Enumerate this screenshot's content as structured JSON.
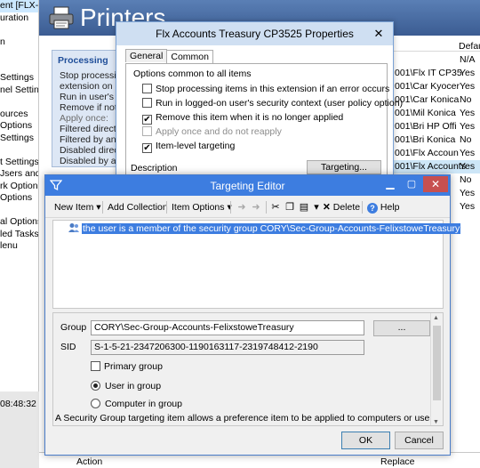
{
  "left_tree": {
    "items": [
      "ent [FLX-D",
      "uration",
      "",
      "n",
      "",
      "",
      "Settings",
      "nel Setting",
      "",
      "ources",
      "Options",
      "Settings",
      "",
      "t Settings",
      "Jsers and G",
      "rk Options",
      "Options",
      "",
      "al Options",
      "led Tasks",
      "lenu"
    ],
    "selected_index": 0
  },
  "left_status": {
    "time": "08:48:32"
  },
  "printers": {
    "title": "Printers"
  },
  "processing": {
    "title": "Processing",
    "lines": [
      {
        "text": "Stop processing",
        "muted": false
      },
      {
        "text": "extension on err",
        "muted": false
      },
      {
        "text": "Run in user's co",
        "muted": false
      },
      {
        "text": "Remove if not a",
        "muted": false
      },
      {
        "text": "Apply once:",
        "muted": true
      },
      {
        "text": "Filtered directly:",
        "muted": false
      },
      {
        "text": "Filtered by ance",
        "muted": false
      },
      {
        "text": "Disabled directly",
        "muted": false
      },
      {
        "text": "Disabled by anc",
        "muted": false
      }
    ]
  },
  "list": {
    "default_header": "Defau",
    "rows": [
      {
        "name": "",
        "def": "N/A",
        "selected": false
      },
      {
        "name": "001\\Flx IT CP35",
        "def": "Yes",
        "selected": false
      },
      {
        "name": "001\\Car Kyocer",
        "def": "Yes",
        "selected": false
      },
      {
        "name": "001\\Car Konica",
        "def": "No",
        "selected": false
      },
      {
        "name": "001\\Mil Konica",
        "def": "Yes",
        "selected": false
      },
      {
        "name": "001\\Bri HP Offi",
        "def": "Yes",
        "selected": false
      },
      {
        "name": "001\\Bri Konica",
        "def": "No",
        "selected": false
      },
      {
        "name": "001\\Flx Accoun",
        "def": "Yes",
        "selected": false
      },
      {
        "name": "001\\Flx Accounts",
        "def": "Yes",
        "selected": true
      },
      {
        "name": "",
        "def": "No",
        "selected": false
      },
      {
        "name": "",
        "def": "Yes",
        "selected": false
      },
      {
        "name": "",
        "def": "Yes",
        "selected": false
      }
    ]
  },
  "bottom_bar": {
    "action": "Action",
    "replace": "Replace"
  },
  "properties_dialog": {
    "title": "Flx Accounts Treasury CP3525 Properties",
    "close": "✕",
    "tabs": [
      "General",
      "Common"
    ],
    "active_tab": "Common",
    "group_label": "Options common to all items",
    "options": [
      {
        "label": "Stop processing items in this extension if an error occurs",
        "checked": false,
        "disabled": false
      },
      {
        "label": "Run in logged-on user's security context (user policy option)",
        "checked": false,
        "disabled": false
      },
      {
        "label": "Remove this item when it is no longer applied",
        "checked": true,
        "disabled": false
      },
      {
        "label": "Apply once and do not reapply",
        "checked": false,
        "disabled": true
      },
      {
        "label": "Item-level targeting",
        "checked": true,
        "disabled": false
      }
    ],
    "targeting_button": "Targeting...",
    "description_label": "Description"
  },
  "targeting_editor": {
    "title": "Targeting Editor",
    "toolbar": {
      "new_item": "New Item",
      "add_collection": "Add Collection",
      "item_options": "Item Options",
      "delete": "Delete",
      "help": "Help"
    },
    "tree_item": "the user is a member of the security group CORY\\Sec-Group-Accounts-FelixstoweTreasury",
    "group_label": "Group",
    "group_value": "CORY\\Sec-Group-Accounts-FelixstoweTreasury",
    "browse_label": "...",
    "sid_label": "SID",
    "sid_value": "S-1-5-21-2347206300-1190163117-2319748412-2190",
    "primary_group_label": "Primary group",
    "primary_group_checked": false,
    "user_in_group_label": "User in group",
    "computer_in_group_label": "Computer in group",
    "selected_scope": "user",
    "help_text": "A Security Group targeting item allows a preference item to be applied to computers or users only if",
    "ok": "OK",
    "cancel": "Cancel"
  }
}
